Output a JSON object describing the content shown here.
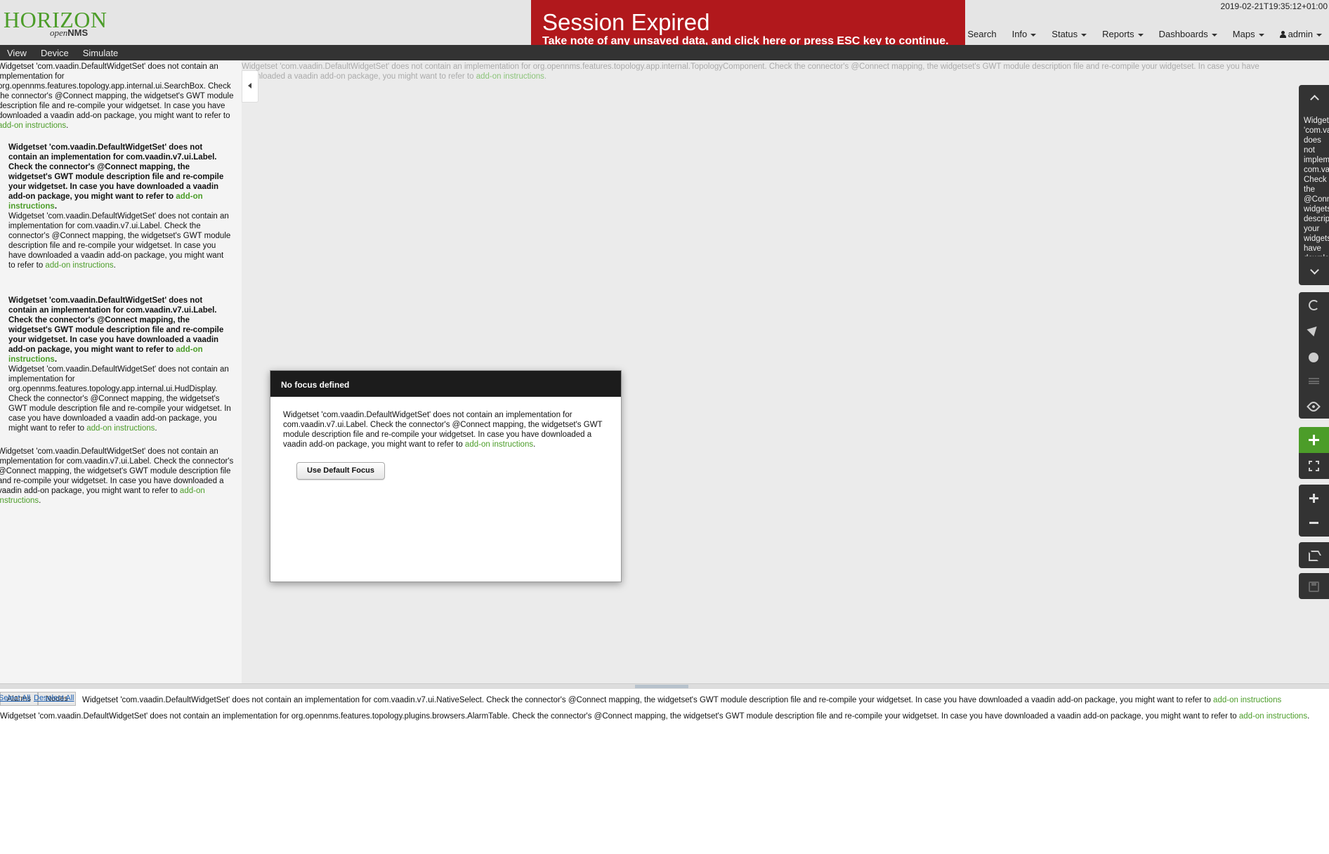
{
  "header": {
    "logo_main": "HORIZON",
    "logo_sub_italic": "open",
    "logo_sub_bold": "NMS",
    "timestamp": "2019-02-21T19:35:12+01:00",
    "nav": {
      "search": "Search",
      "info": "Info",
      "status": "Status",
      "reports": "Reports",
      "dashboards": "Dashboards",
      "maps": "Maps",
      "user": "admin"
    }
  },
  "session": {
    "title": "Session Expired",
    "msg_before": "Take note of any unsaved data, and ",
    "msg_link": "click here",
    "msg_after": " or press ESC key to continue."
  },
  "menubar": {
    "view": "View",
    "device": "Device",
    "simulate": "Simulate"
  },
  "link_text": "add-on instructions",
  "link_line1": "add-on",
  "link_line2": "instructions",
  "left": {
    "searchbox": "Widgetset 'com.vaadin.DefaultWidgetSet' does not contain an implementation for org.opennms.features.topology.app.internal.ui.SearchBox. Check the connector's @Connect mapping, the widgetset's GWT module description file and re-compile your widgetset. In case you have downloaded a vaadin add-on package, you might want to refer to ",
    "label_bold_1": "Widgetset 'com.vaadin.DefaultWidgetSet' does not contain an implementation for com.vaadin.v7.ui.Label. Check the connector's @Connect mapping, the widgetset's GWT module description file and re-compile your widgetset. In case you have downloaded a vaadin add-on package, you might want to refer to ",
    "label_plain_1": "Widgetset 'com.vaadin.DefaultWidgetSet' does not contain an implementation for com.vaadin.v7.ui.Label. Check the connector's @Connect mapping, the widgetset's GWT module description file and re-compile your widgetset. In case you have downloaded a vaadin add-on package, you might want to refer to ",
    "label_bold_2": "Widgetset 'com.vaadin.DefaultWidgetSet' does not contain an implementation for com.vaadin.v7.ui.Label. Check the connector's @Connect mapping, the widgetset's GWT module description file and re-compile your widgetset. In case you have downloaded a vaadin add-on package, you might want to refer to ",
    "hud": "Widgetset 'com.vaadin.DefaultWidgetSet' does not contain an implementation for org.opennms.features.topology.app.internal.ui.HudDisplay. Check the connector's @Connect mapping, the widgetset's GWT module description file and re-compile your widgetset. In case you have downloaded a vaadin add-on package, you might want to refer to ",
    "label_plain_2": "Widgetset 'com.vaadin.DefaultWidgetSet' does not contain an implementation for com.vaadin.v7.ui.Label. Check the connector's @Connect mapping, the widgetset's GWT module description file and re-compile your widgetset. In case you have downloaded a vaadin add-on package, you might want to refer to "
  },
  "topology_msg": "Widgetset 'com.vaadin.DefaultWidgetSet' does not contain an implementation for org.opennms.features.topology.app.internal.TopologyComponent. Check the connector's @Connect mapping, the widgetset's GWT module description file and re-compile your widgetset. In case you have downloaded a vaadin add-on package, you might want to refer to ",
  "right_info": "Widgetset\n'com.vaadin.\ndoes not\nimplementation\ncom.vaadin\nCheck the\n@Connect\nwidgetset's\ndescription\nyour widgetset\nhave downloaded\nadd-on\nwant to refer\ninstructions",
  "dialog": {
    "title": "No focus defined",
    "body": "Widgetset 'com.vaadin.DefaultWidgetSet' does not contain an implementation for com.vaadin.v7.ui.Label. Check the connector's @Connect mapping, the widgetset's GWT module description file and re-compile your widgetset. In case you have downloaded a vaadin add-on package, you might want to refer to ",
    "button": "Use Default Focus"
  },
  "bottom": {
    "tab_alarms": "Alarms",
    "tab_nodes": "Nodes",
    "select_all": "Select All",
    "deselect_all": "Deselect All",
    "nativeselect": "Widgetset 'com.vaadin.DefaultWidgetSet' does not contain an implementation for com.vaadin.v7.ui.NativeSelect. Check the connector's @Connect mapping, the widgetset's GWT module description file and re-compile your widgetset. In case you have downloaded a vaadin add-on package, you might want to refer to ",
    "alarmtable": "Widgetset 'com.vaadin.DefaultWidgetSet' does not contain an implementation for org.opennms.features.topology.plugins.browsers.AlarmTable. Check the connector's @Connect mapping, the widgetset's GWT module description file and re-compile your widgetset. In case you have downloaded a vaadin add-on package, you might want to refer to "
  }
}
